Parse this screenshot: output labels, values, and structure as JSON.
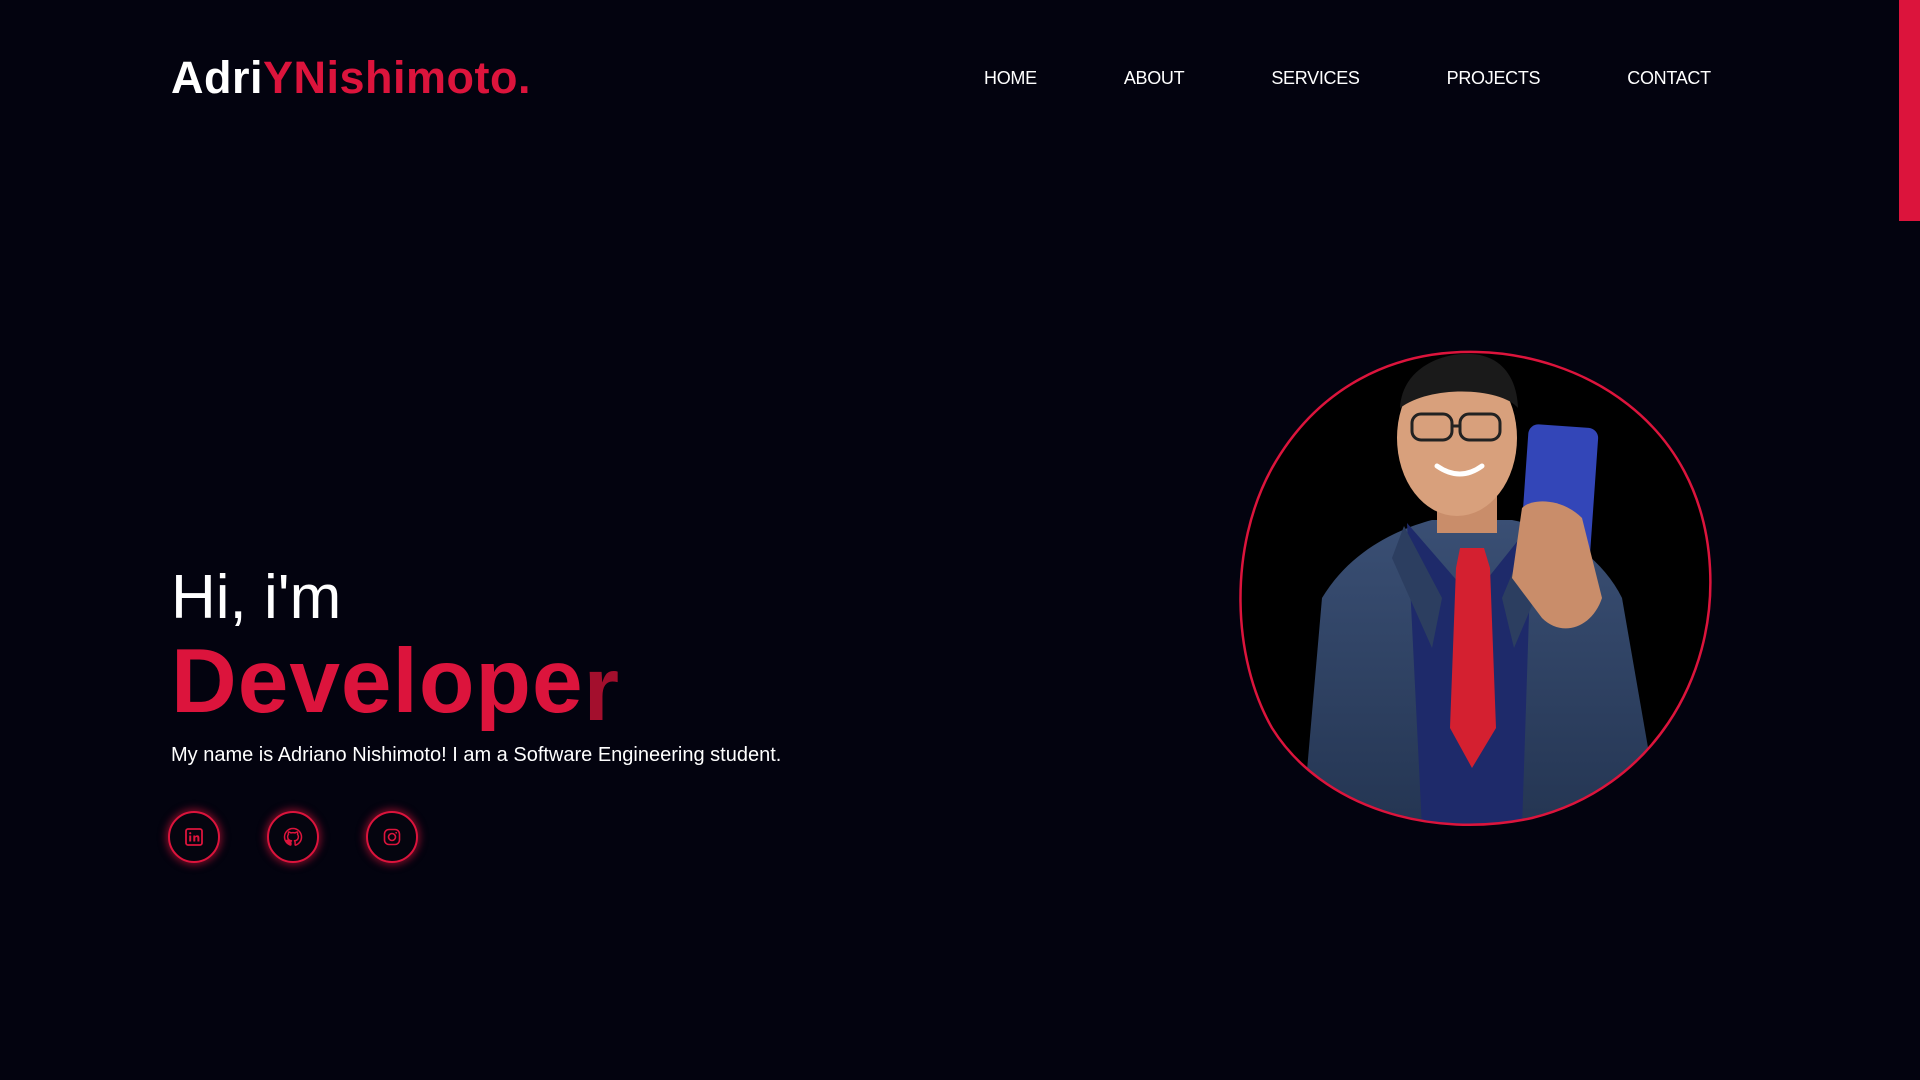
{
  "header": {
    "logo_part1": "Adri",
    "logo_part2": "YNishimoto.",
    "nav": {
      "home": "HOME",
      "about": "ABOUT",
      "services": "SERVICES",
      "projects": "PROJECTS",
      "contact": "CONTACT"
    }
  },
  "hero": {
    "greeting": "Hi, i'm",
    "role_main": "Develope",
    "role_last": "r",
    "intro": "My name is Adriano Nishimoto! I am a Software Engineering student."
  },
  "socials": [
    {
      "icon": "linkedin-icon"
    },
    {
      "icon": "github-icon"
    },
    {
      "icon": "instagram-icon"
    }
  ],
  "colors": {
    "background": "#03030f",
    "accent": "#dc143c",
    "text": "#ffffff"
  }
}
